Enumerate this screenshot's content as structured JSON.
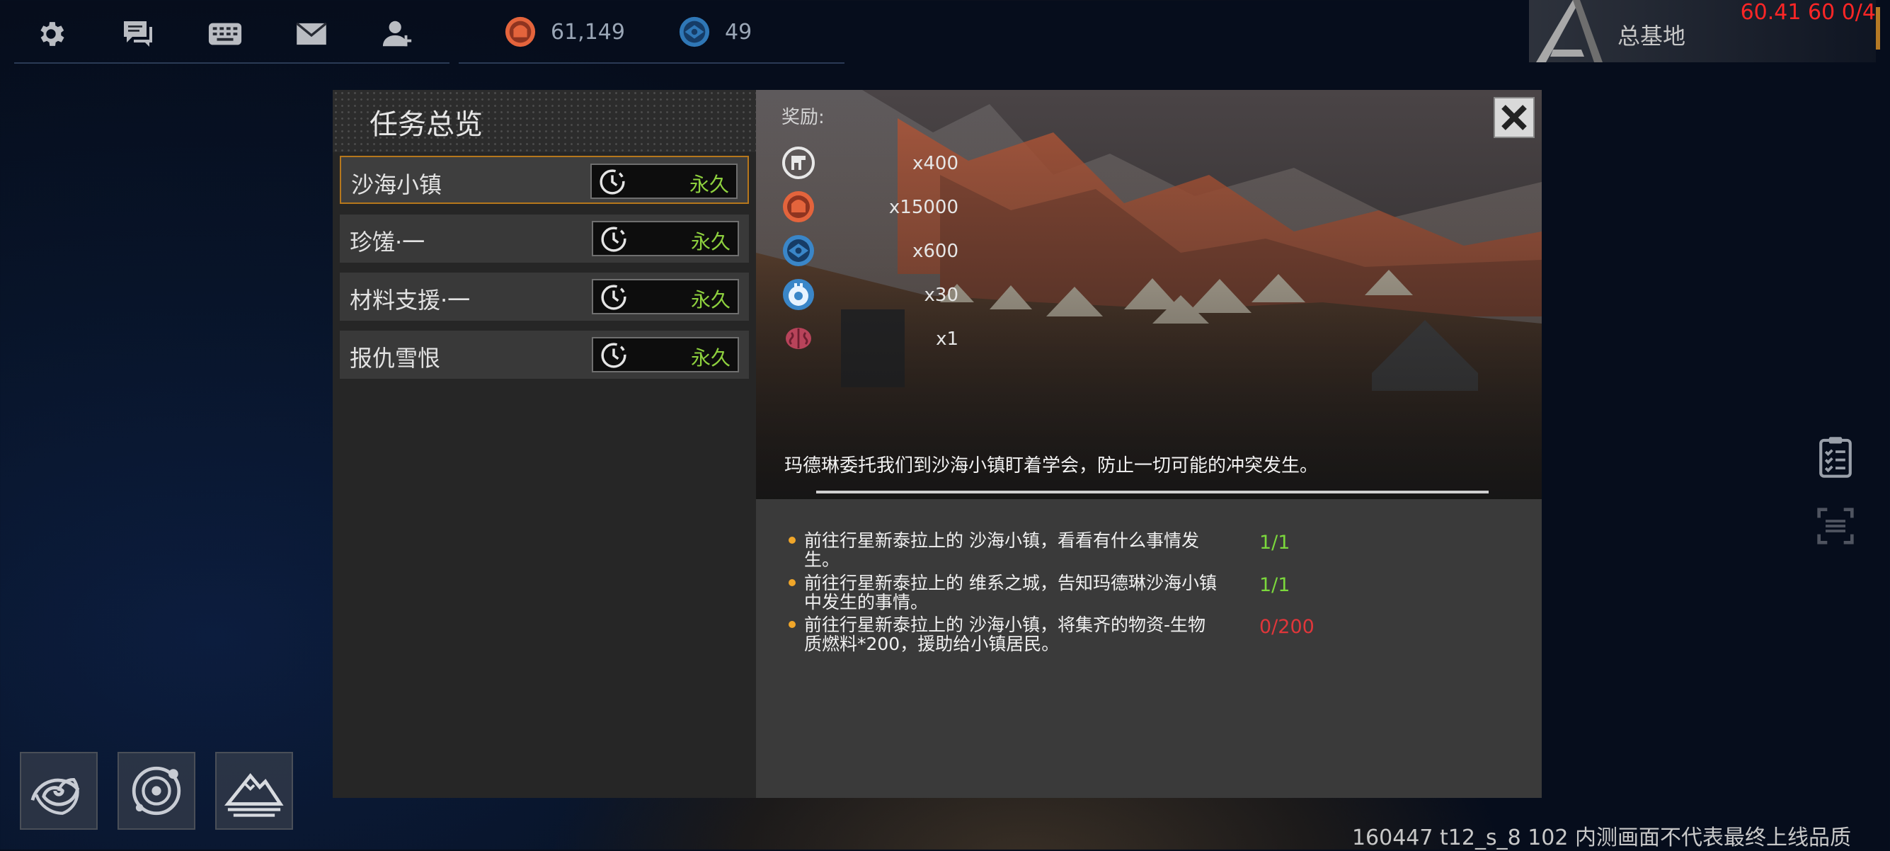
{
  "top_bar": {
    "icons": [
      "gear-icon",
      "chat-icon",
      "keyboard-icon",
      "mail-icon",
      "friends-icon"
    ],
    "resources": [
      {
        "icon": "orange-resource-icon",
        "value": "61,149",
        "color": "#e4643c"
      },
      {
        "icon": "blue-resource-icon",
        "value": "49",
        "color": "#2f77b6"
      }
    ],
    "base_name": "总基地",
    "debug_stats": "60.41 60 0/4"
  },
  "task_panel": {
    "title": "任务总览",
    "tasks": [
      {
        "name": "沙海小镇",
        "duration": "永久",
        "selected": true
      },
      {
        "name": "珍馐·一",
        "duration": "永久",
        "selected": false
      },
      {
        "name": "材料支援·一",
        "duration": "永久",
        "selected": false
      },
      {
        "name": "报仇雪恨",
        "duration": "永久",
        "selected": false
      }
    ]
  },
  "detail": {
    "reward_label": "奖励:",
    "rewards": [
      {
        "icon": "badge-token-icon",
        "qty": "x400"
      },
      {
        "icon": "orange-resource-icon",
        "qty": "x15000"
      },
      {
        "icon": "blue-resource-icon",
        "qty": "x600"
      },
      {
        "icon": "blue-crystal-icon",
        "qty": "x30"
      },
      {
        "icon": "brain-item-icon",
        "qty": "x1"
      }
    ],
    "description": "玛德琳委托我们到沙海小镇盯着学会，防止一切可能的冲突发生。",
    "objectives": [
      {
        "text": "前往行星新泰拉上的 沙海小镇，看看有什么事情发生。",
        "progress": "1/1",
        "complete": true
      },
      {
        "text": "前往行星新泰拉上的 维系之城，告知玛德琳沙海小镇中发生的事情。",
        "progress": "1/1",
        "complete": true
      },
      {
        "text": "前往行星新泰拉上的 沙海小镇，将集齐的物资-生物质燃料*200，援助给小镇居民。",
        "progress": "0/200",
        "complete": false
      }
    ],
    "colors": {
      "complete": "#7bd83c",
      "incomplete": "#e0363a",
      "accent_border": "#b6771c"
    }
  },
  "side_icons": [
    "clipboard-icon",
    "scan-icon"
  ],
  "bottom_buttons": [
    "galaxy-icon",
    "planet-system-icon",
    "mountain-base-icon"
  ],
  "footer": "160447 t12_s_8 102  内测画面不代表最终上线品质"
}
